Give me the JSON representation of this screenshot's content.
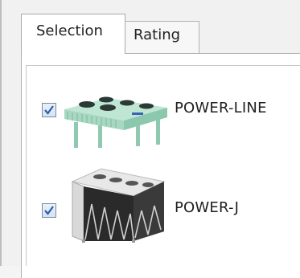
{
  "tabs": [
    {
      "label": "Selection",
      "active": true
    },
    {
      "label": "Rating",
      "active": false
    }
  ],
  "products": [
    {
      "name": "POWER-LINE",
      "checked": true,
      "image": "dry-cooler-horizontal"
    },
    {
      "name": "POWER-J",
      "checked": true,
      "image": "dry-cooler-v-type"
    }
  ],
  "colors": {
    "checkmark": "#2a5db0",
    "unit_body_green": "#a9d8c2",
    "unit_body_dark": "#2a2a2a"
  }
}
